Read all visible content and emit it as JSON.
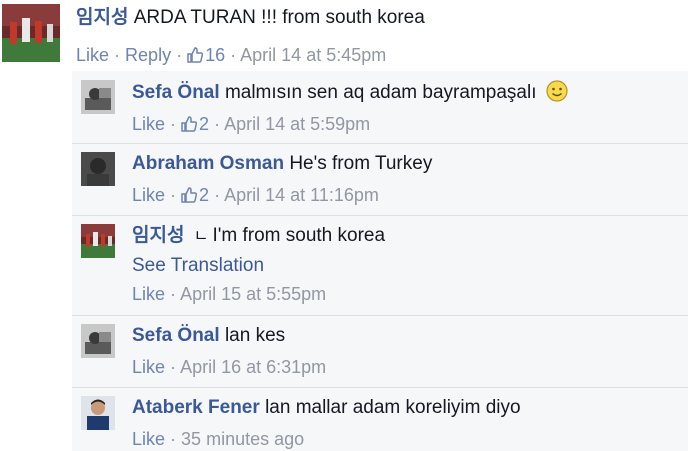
{
  "colors": {
    "link": "#3b5998",
    "action": "#6d84b4",
    "meta": "#9197a3",
    "thread_bg": "#f6f7f9",
    "divider": "#dddfe2"
  },
  "comments": [
    {
      "author": "임지성",
      "text": "ARDA TURAN !!! from south korea",
      "like": "Like",
      "reply": "Reply",
      "likes": "16",
      "time": "April 14 at 5:45pm"
    },
    {
      "author": "Sefa Önal",
      "text": "malmısın sen aq adam bayrampaşalı",
      "emoji": "smiley-icon",
      "like": "Like",
      "likes": "2",
      "time": "April 14 at 5:59pm"
    },
    {
      "author": "Abraham Osman",
      "text": "He's from Turkey",
      "like": "Like",
      "likes": "2",
      "time": "April 14 at 11:16pm"
    },
    {
      "author": "임지성",
      "reply_marker": "ㄴ",
      "text": "I'm from south korea",
      "see_translation": "See Translation",
      "like": "Like",
      "time": "April 15 at 5:55pm"
    },
    {
      "author": "Sefa Önal",
      "text": "lan kes",
      "like": "Like",
      "time": "April 16 at 6:31pm"
    },
    {
      "author": "Ataberk Fener",
      "text": "lan mallar adam koreliyim diyo",
      "like": "Like",
      "time": "35 minutes ago"
    }
  ]
}
